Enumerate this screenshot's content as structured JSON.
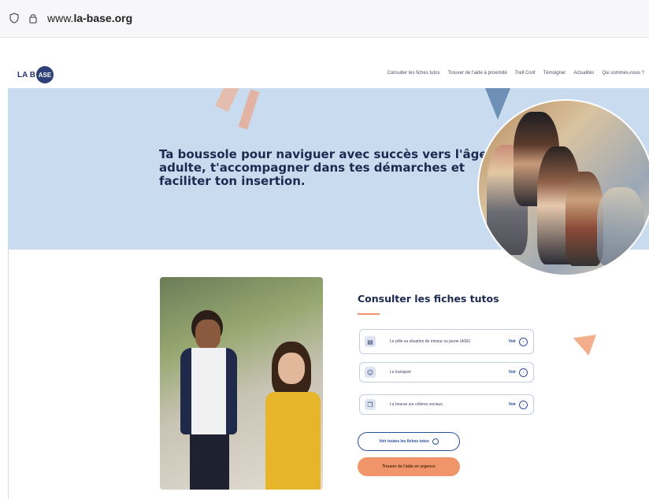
{
  "browser": {
    "url_prefix": "www.",
    "url_host": "la-base.org"
  },
  "site": {
    "logo_text": "LA B",
    "logo_circle": "ASE",
    "nav": [
      "Consulter les fiches tutos",
      "Trouver de l'aide à proximité",
      "Trell Conf",
      "Témoigner",
      "Actualités",
      "Qui sommes-nous ?"
    ]
  },
  "hero": {
    "title": "Ta boussole pour naviguer avec succès vers l'âge adulte, t'accompagner dans tes démarches et faciliter ton insertion."
  },
  "section": {
    "title": "Consulter les fiches tutos",
    "cards": [
      {
        "label": "Le pôle ou situation de mineur ou jeune (ASE)",
        "action": "Voir",
        "icon": "document-icon"
      },
      {
        "label": "Le transport",
        "action": "Voir",
        "icon": "person-icon"
      },
      {
        "label": "La bourse sur critères sociaux",
        "action": "Voir",
        "icon": "book-icon"
      }
    ],
    "btn_all": "Voir toutes les fiches tutos",
    "btn_help": "Trouver de l'aide en urgence"
  },
  "colors": {
    "hero_bg": "#c9dcef",
    "accent_orange": "#f0956a",
    "accent_blue": "#2e4fa0",
    "navy": "#1d2a50"
  }
}
